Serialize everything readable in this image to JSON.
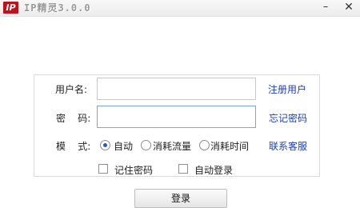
{
  "window": {
    "icon_text": "IP",
    "title": "IP精灵3.0.0",
    "minimize_glyph": "–",
    "close_glyph": "✕"
  },
  "form": {
    "username_label": "用户名:",
    "username_value": "",
    "password_label": "密    码:",
    "password_value": "",
    "mode_label": "模    式:",
    "modes": [
      {
        "label": "自动",
        "selected": true
      },
      {
        "label": "消耗流量",
        "selected": false
      },
      {
        "label": "消耗时间",
        "selected": false
      }
    ],
    "remember_password_label": "记住密码",
    "remember_password_checked": false,
    "auto_login_label": "自动登录",
    "auto_login_checked": false
  },
  "links": {
    "register": "注册用户",
    "forgot_password": "忘记密码",
    "contact_support": "联系客服"
  },
  "login_button": "登录",
  "colors": {
    "link": "#1a3fb8",
    "radio_selected": "#1f5fbf",
    "icon_bg": "#c0101c"
  }
}
